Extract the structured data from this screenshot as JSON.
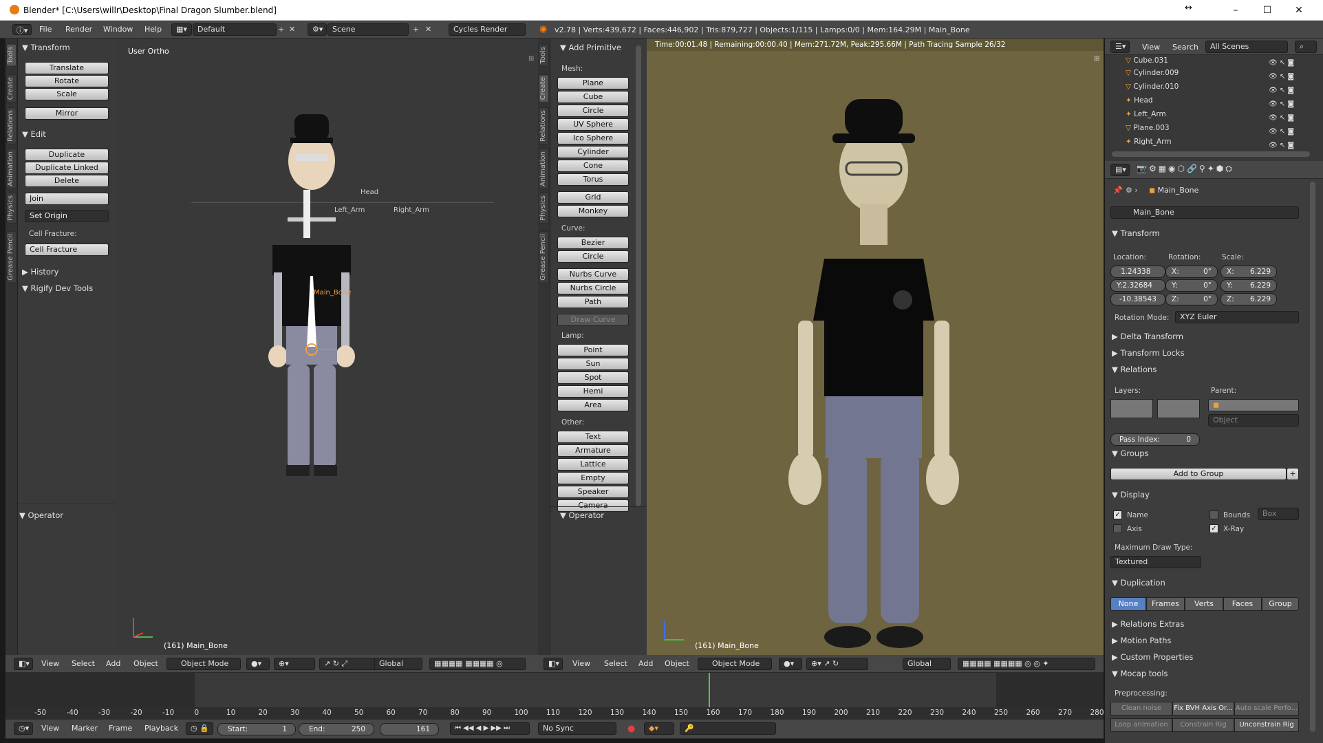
{
  "window": {
    "title": "Blender* [C:\\Users\\willr\\Desktop\\Final Dragon Slumber.blend]",
    "min": "–",
    "max": "☐",
    "close": "✕",
    "resize": "↔"
  },
  "info": {
    "menus": [
      "File",
      "Render",
      "Window",
      "Help"
    ],
    "screen_layout": "Default",
    "scene": "Scene",
    "engine": "Cycles Render",
    "stats": "v2.78 | Verts:439,672 | Faces:446,902 | Tris:879,727 | Objects:1/115 | Lamps:0/0 | Mem:164.29M | Main_Bone"
  },
  "left_tools": {
    "tabs": [
      "Tools",
      "Create",
      "Relations",
      "Animation",
      "Physics",
      "Grease Pencil"
    ],
    "transform_title": "Transform",
    "transform_buttons": [
      "Translate",
      "Rotate",
      "Scale"
    ],
    "mirror": "Mirror",
    "edit_title": "Edit",
    "edit_buttons": [
      "Duplicate",
      "Duplicate Linked",
      "Delete"
    ],
    "join": "Join",
    "set_origin": "Set Origin",
    "cell_fracture_label": "Cell Fracture:",
    "cell_fracture": "Cell Fracture",
    "history": "History",
    "rigify": "Rigify Dev Tools",
    "operator": "Operator"
  },
  "viewport_left": {
    "label": "User Ortho",
    "status": "(161) Main_Bone",
    "bone_labels": {
      "head": "Head",
      "left_arm": "Left_Arm",
      "right_arm": "Right_Arm",
      "main": "Main_Bone"
    }
  },
  "add_primitive": {
    "tabs": [
      "Tools",
      "Create",
      "Relations",
      "Animation",
      "Physics",
      "Grease Pencil"
    ],
    "title": "Add Primitive",
    "mesh_label": "Mesh:",
    "mesh": [
      "Plane",
      "Cube",
      "Circle",
      "UV Sphere",
      "Ico Sphere",
      "Cylinder",
      "Cone",
      "Torus"
    ],
    "mesh2": [
      "Grid",
      "Monkey"
    ],
    "curve_label": "Curve:",
    "curve": [
      "Bezier",
      "Circle"
    ],
    "curve2": [
      "Nurbs Curve",
      "Nurbs Circle",
      "Path"
    ],
    "draw_curve": "Draw Curve",
    "lamp_label": "Lamp:",
    "lamp": [
      "Point",
      "Sun",
      "Spot",
      "Hemi",
      "Area"
    ],
    "other_label": "Other:",
    "other": [
      "Text",
      "Armature",
      "Lattice",
      "Empty",
      "Speaker",
      "Camera"
    ],
    "operator": "Operator"
  },
  "viewport_right": {
    "render_status": "Time:00:01.48 | Remaining:00:00.40 | Mem:271.72M, Peak:295.66M | Path Tracing Sample 26/32",
    "status": "(161) Main_Bone"
  },
  "viewport_header": {
    "menus": [
      "View",
      "Select",
      "Add",
      "Object"
    ],
    "mode": "Object Mode",
    "orientation": "Global"
  },
  "outliner": {
    "menus": [
      "View",
      "Search"
    ],
    "display": "All Scenes",
    "items": [
      "Cube.031",
      "Cylinder.009",
      "Cylinder.010",
      "Head",
      "Left_Arm",
      "Plane.003",
      "Right_Arm"
    ]
  },
  "properties": {
    "context": "Main_Bone",
    "name_field": "Main_Bone",
    "transform_title": "Transform",
    "location_label": "Location:",
    "rotation_label": "Rotation:",
    "scale_label": "Scale:",
    "location": [
      "1.24338",
      "Y:2.32684",
      "-10.38543"
    ],
    "rotation": [
      "X:",
      "0°",
      "Y:",
      "0°",
      "Z:",
      "0°"
    ],
    "scale": [
      "X:",
      "6.229",
      "Y:",
      "6.229",
      "Z:",
      "6.229"
    ],
    "rotation_mode_label": "Rotation Mode:",
    "rotation_mode": "XYZ Euler",
    "delta_transform": "Delta Transform",
    "transform_locks": "Transform Locks",
    "relations": "Relations",
    "layers_label": "Layers:",
    "parent_label": "Parent:",
    "parent_type": "Object",
    "pass_index_label": "Pass Index:",
    "pass_index": "0",
    "groups": "Groups",
    "add_to_group": "Add to Group",
    "display": "Display",
    "name_check": "Name",
    "bounds_check": "Bounds",
    "bounds_type": "Box",
    "axis_check": "Axis",
    "xray_check": "X-Ray",
    "max_draw_label": "Maximum Draw Type:",
    "max_draw": "Textured",
    "duplication": "Duplication",
    "dup_options": [
      "None",
      "Frames",
      "Verts",
      "Faces",
      "Group"
    ],
    "relations_extras": "Relations Extras",
    "motion_paths": "Motion Paths",
    "custom_props": "Custom Properties",
    "mocap": "Mocap tools",
    "preprocessing": "Preprocessing:",
    "pre_buttons": [
      "Clean noise",
      "Fix BVH Axis Or...",
      "Auto scale Perfo..."
    ],
    "pre_buttons2": [
      "Loop animation",
      "Constrain Rig",
      "Unconstrain Rig"
    ]
  },
  "timeline": {
    "ticks": [
      "-50",
      "-40",
      "-30",
      "-20",
      "-10",
      "0",
      "10",
      "20",
      "30",
      "40",
      "50",
      "60",
      "70",
      "80",
      "90",
      "100",
      "110",
      "120",
      "130",
      "140",
      "150",
      "160",
      "170",
      "180",
      "190",
      "200",
      "210",
      "220",
      "230",
      "240",
      "250",
      "260",
      "270",
      "280"
    ],
    "menus": [
      "View",
      "Marker",
      "Frame",
      "Playback"
    ],
    "start_label": "Start:",
    "start": "1",
    "end_label": "End:",
    "end": "250",
    "current": "161",
    "sync": "No Sync"
  }
}
